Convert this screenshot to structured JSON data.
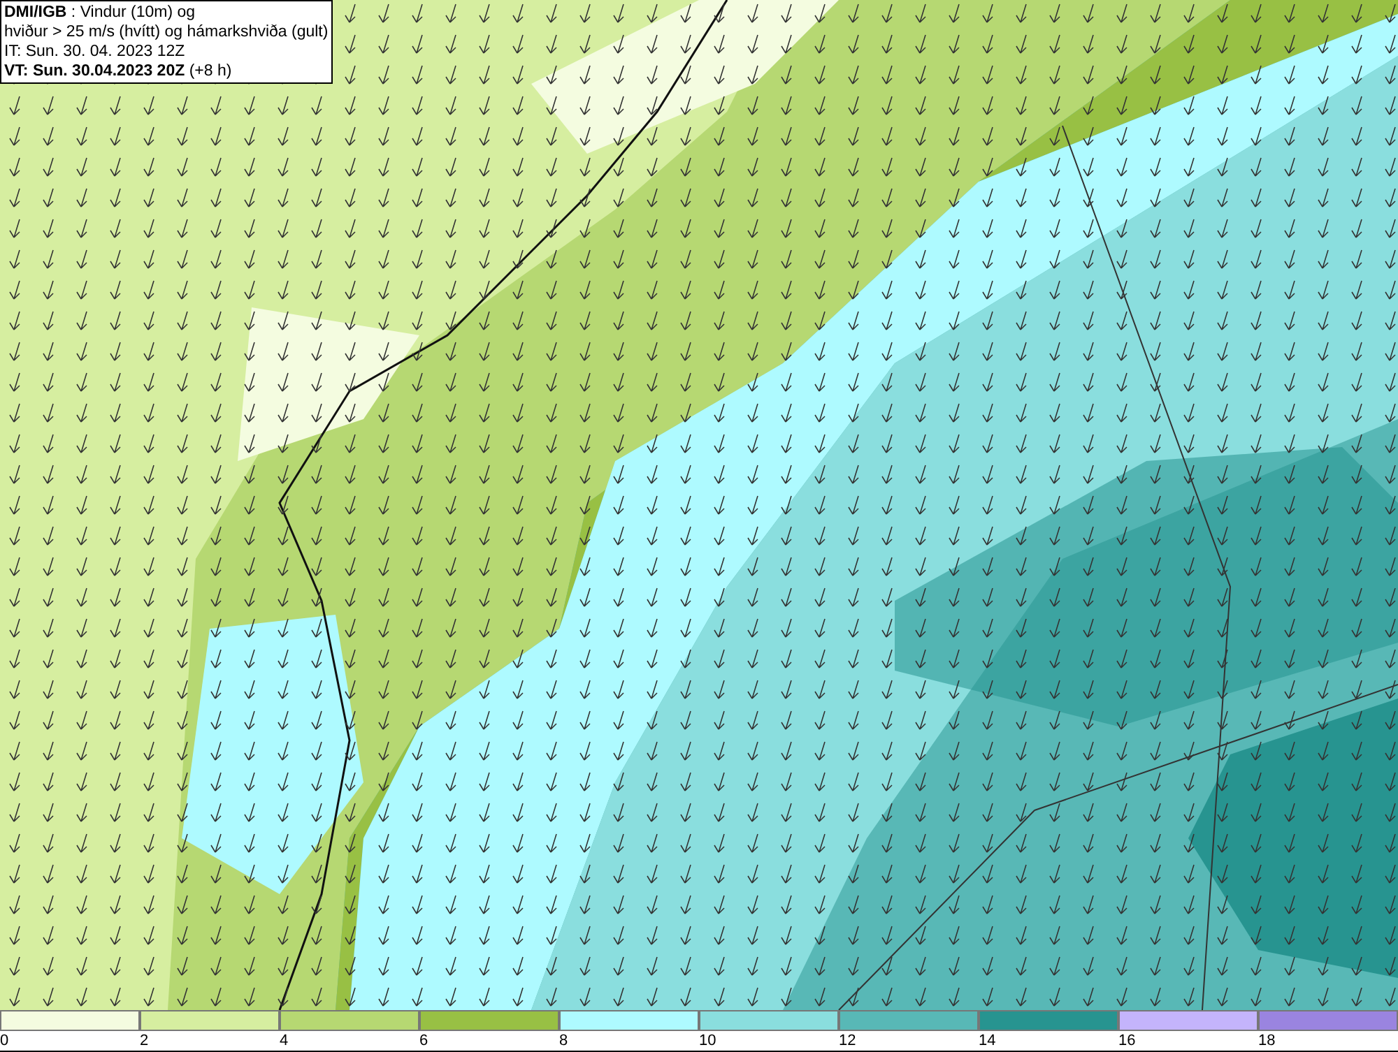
{
  "header": {
    "lines": [
      "**DMI/IGB** : Vindur (10m) og",
      "hviður > 25 m/s (hvítt) og hámarkshviða (gult)",
      "IT: Sun. 30. 04. 2023 12Z",
      "**VT: Sun. 30.04.2023 20Z** (+8 h)"
    ]
  },
  "legend": [
    {
      "label": "0",
      "color": "#f4fce0"
    },
    {
      "label": "2",
      "color": "#d6eea0"
    },
    {
      "label": "4",
      "color": "#b6d872"
    },
    {
      "label": "6",
      "color": "#98c044"
    },
    {
      "label": "8",
      "color": "#aefaff"
    },
    {
      "label": "10",
      "color": "#8adede"
    },
    {
      "label": "12",
      "color": "#58b8b6"
    },
    {
      "label": "14",
      "color": "#279490"
    },
    {
      "label": "16",
      "color": "#c4b4fc"
    },
    {
      "label": "18",
      "color": "#9a84e0"
    }
  ]
}
